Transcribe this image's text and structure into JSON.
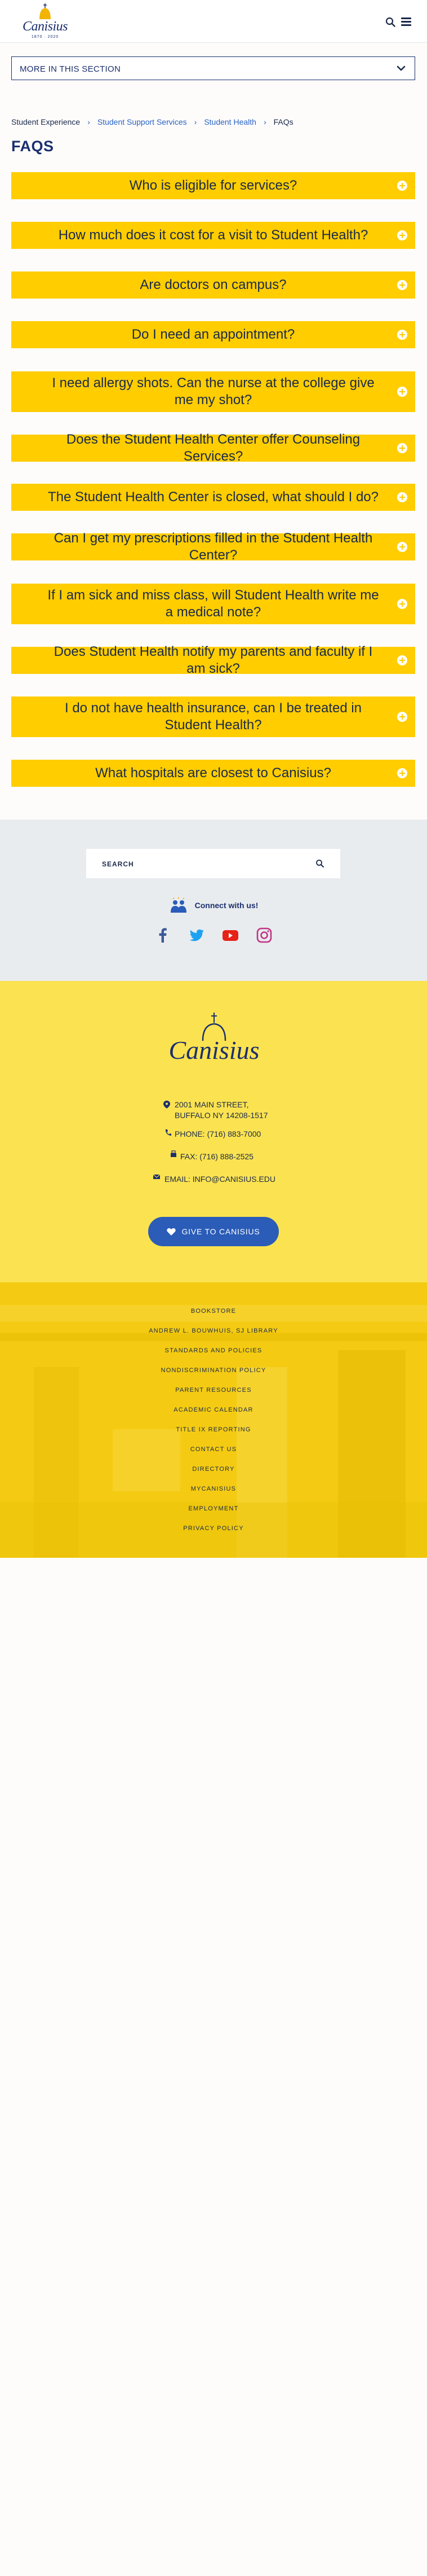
{
  "header": {
    "logo_text": "Canisius",
    "logo_years": "1870 · 2020",
    "search_icon": "search-icon",
    "menu_icon": "hamburger-menu-icon"
  },
  "section_menu": {
    "label": "MORE IN THIS SECTION",
    "icon": "chevron-down-icon"
  },
  "breadcrumb": [
    {
      "label": "Student Experience",
      "link": false
    },
    {
      "label": "Student Support Services",
      "link": true
    },
    {
      "label": "Student Health",
      "link": true
    },
    {
      "label": "FAQs",
      "link": false
    }
  ],
  "page_title": "FAQS",
  "faqs": [
    "Who is eligible for services?",
    "How much does it cost for a visit to Student Health?",
    "Are doctors on campus?",
    "Do I need an appointment?",
    "I need allergy shots. Can the nurse at the college give me my shot?",
    "Does the Student Health Center offer Counseling Services?",
    "The Student Health Center is closed, what should I do?",
    "Can I get my prescriptions filled in the Student Health Center?",
    "If I am sick and miss class, will Student Health write me a medical note?",
    "Does Student Health notify my parents and faculty if I am sick?",
    "I do not have health insurance, can I be treated in Student Health?",
    "What hospitals are closest to Canisius?"
  ],
  "search": {
    "placeholder": "SEARCH",
    "icon": "search-icon"
  },
  "connect": {
    "label": "Connect with us!",
    "socials": [
      {
        "name": "facebook-icon",
        "color": "#3b5998"
      },
      {
        "name": "twitter-icon",
        "color": "#1da1f2"
      },
      {
        "name": "youtube-icon",
        "color": "#e62117"
      },
      {
        "name": "instagram-icon",
        "color": "#c13584"
      }
    ]
  },
  "footer": {
    "logo_text": "Canisius",
    "address_line1": "2001 MAIN STREET,",
    "address_line2": "BUFFALO NY 14208-1517",
    "phone": "PHONE: (716) 883-7000",
    "fax": "FAX: (716) 888-2525",
    "email": "EMAIL: INFO@CANISIUS.EDU",
    "give_label": "GIVE TO CANISIUS"
  },
  "footer_links": [
    "BOOKSTORE",
    "ANDREW L. BOUWHUIS, SJ LIBRARY",
    "STANDARDS AND POLICIES",
    "NONDISCRIMINATION POLICY",
    "PARENT RESOURCES",
    "ACADEMIC CALENDAR",
    "TITLE IX REPORTING",
    "CONTACT US",
    "DIRECTORY",
    "MYCANISIUS",
    "EMPLOYMENT",
    "PRIVACY POLICY"
  ],
  "colors": {
    "brand_navy": "#1b2f6e",
    "faq_yellow": "#ffcd00",
    "footer_yellow": "#fbe251",
    "give_blue": "#2a5cb8"
  }
}
